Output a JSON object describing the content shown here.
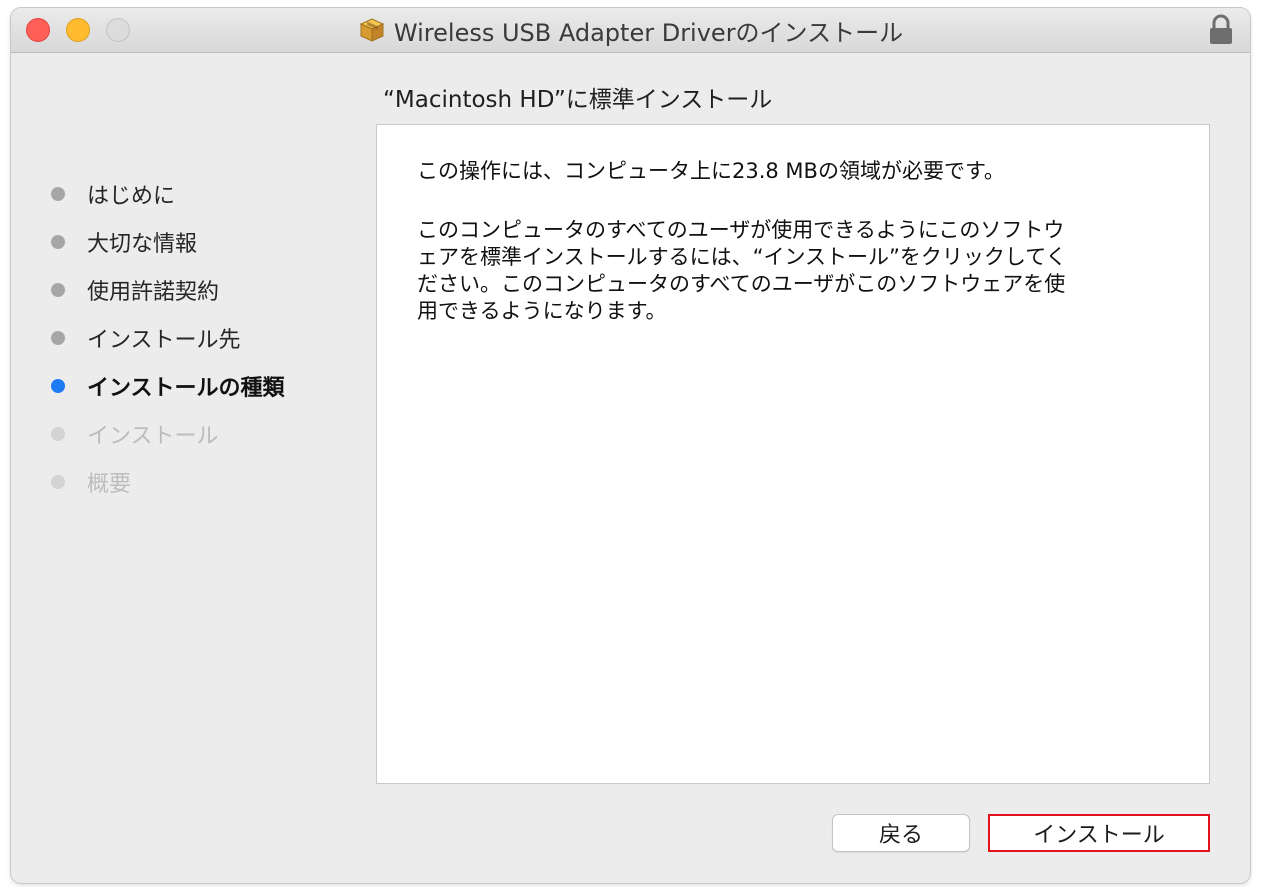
{
  "window": {
    "title": "Wireless USB Adapter Driverのインストール",
    "traffic_lights": {
      "close": "#fe5f57",
      "minimize": "#febc2e",
      "zoom": "#dcdcdc"
    },
    "title_icon": "package-icon",
    "lock_icon": "lock-icon"
  },
  "main": {
    "heading": "“Macintosh HD”に標準インストール",
    "paragraph1": "この操作には、コンピュータ上に23.8 MBの領域が必要です。",
    "paragraph2": "このコンピュータのすべてのユーザが使用できるようにこのソフトウ\nェアを標準インストールするには、“インストール”をクリックしてく\nださい。このコンピュータのすべてのユーザがこのソフトウェアを使\n用できるようになります。"
  },
  "sidebar": {
    "steps": [
      {
        "label": "はじめに",
        "state": "done"
      },
      {
        "label": "大切な情報",
        "state": "done"
      },
      {
        "label": "使用許諾契約",
        "state": "done"
      },
      {
        "label": "インストール先",
        "state": "done"
      },
      {
        "label": "インストールの種類",
        "state": "current"
      },
      {
        "label": "インストール",
        "state": "future"
      },
      {
        "label": "概要",
        "state": "future"
      }
    ],
    "colors": {
      "current": "#1d7cf4",
      "done": "#a6a6a6",
      "future": "#d3d3d3"
    }
  },
  "buttons": {
    "back_label": "戻る",
    "install_label": "インストール",
    "install_highlight_color": "#e0121b"
  }
}
